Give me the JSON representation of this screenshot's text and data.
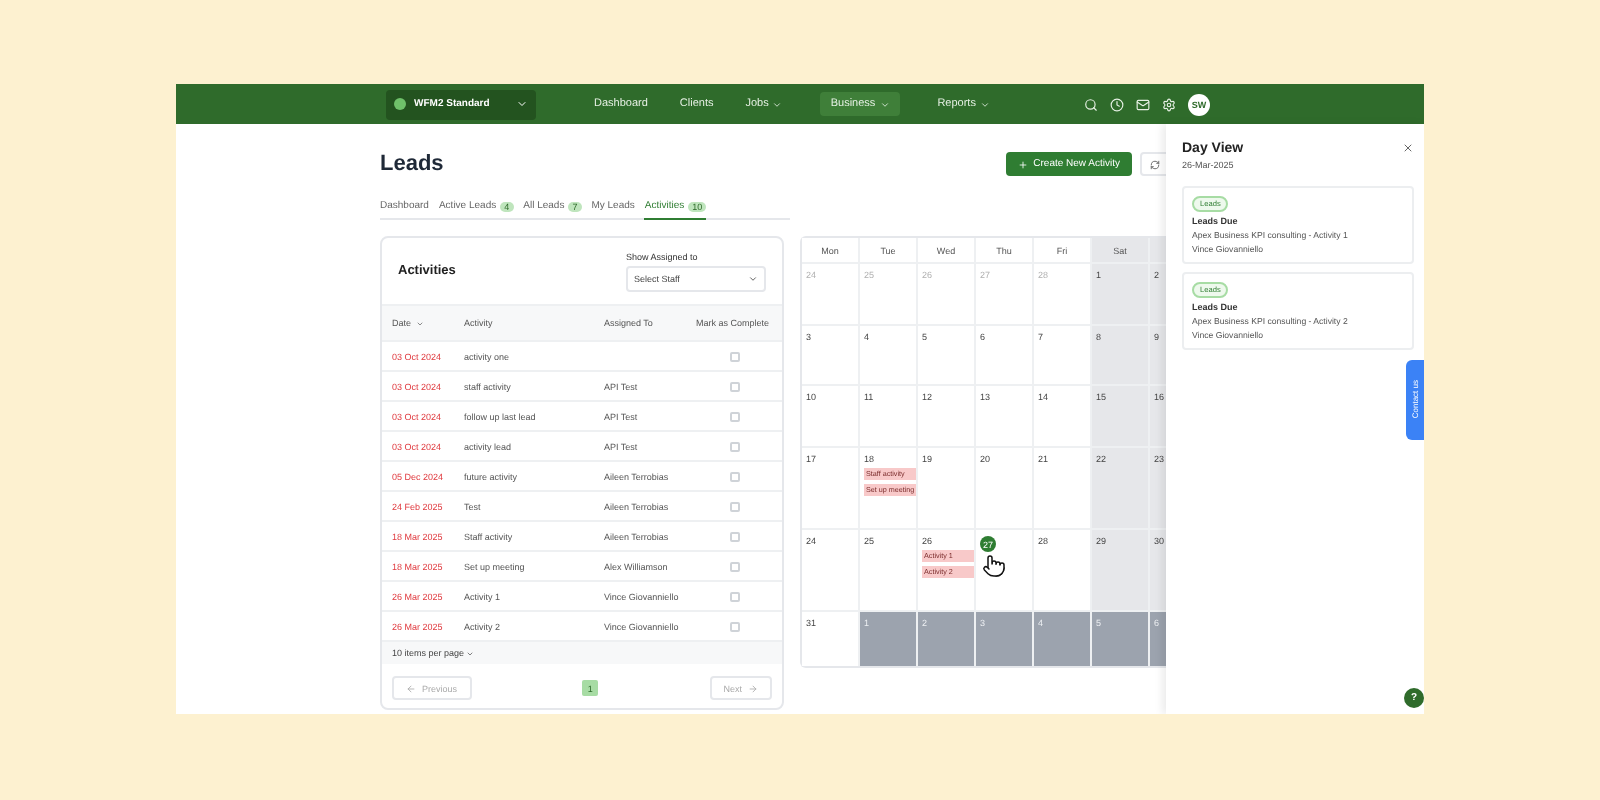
{
  "nav": {
    "workspace": "WFM2 Standard",
    "links": [
      {
        "label": "Dashboard",
        "dropdown": false,
        "selected": false
      },
      {
        "label": "Clients",
        "dropdown": false,
        "selected": false
      },
      {
        "label": "Jobs",
        "dropdown": true,
        "selected": false
      },
      {
        "label": "Business",
        "dropdown": true,
        "selected": true
      },
      {
        "label": "Reports",
        "dropdown": true,
        "selected": false
      }
    ],
    "avatar": "SW"
  },
  "page": {
    "title": "Leads",
    "create_button": "Create New Activity"
  },
  "tabs": [
    {
      "label": "Dashboard",
      "selected": false
    },
    {
      "label": "Active Leads",
      "count": "4",
      "selected": false
    },
    {
      "label": "All Leads",
      "count": "7",
      "selected": false
    },
    {
      "label": "My Leads",
      "selected": false
    },
    {
      "label": "Activities",
      "count": "10",
      "selected": true
    }
  ],
  "activities": {
    "title": "Activities",
    "filter_label": "Show Assigned to",
    "filter_placeholder": "Select Staff",
    "columns": [
      {
        "label": "Date",
        "sortable": true
      },
      {
        "label": "Activity",
        "sortable": false
      },
      {
        "label": "Assigned To",
        "sortable": false
      },
      {
        "label": "Mark as Complete",
        "sortable": false
      }
    ],
    "rows": [
      {
        "date": "03 Oct 2024",
        "activity": "activity one",
        "assigned": "",
        "checked": false
      },
      {
        "date": "03 Oct 2024",
        "activity": "staff activity",
        "assigned": "API Test",
        "checked": false
      },
      {
        "date": "03 Oct 2024",
        "activity": "follow up last lead",
        "assigned": "API Test",
        "checked": false
      },
      {
        "date": "03 Oct 2024",
        "activity": "activity lead",
        "assigned": "API Test",
        "checked": false
      },
      {
        "date": "05 Dec 2024",
        "activity": "future activity",
        "assigned": "Aileen Terrobias",
        "checked": false
      },
      {
        "date": "24 Feb 2025",
        "activity": "Test",
        "assigned": "Aileen Terrobias",
        "checked": false
      },
      {
        "date": "18 Mar 2025",
        "activity": "Staff activity",
        "assigned": "Aileen Terrobias",
        "checked": false
      },
      {
        "date": "18 Mar 2025",
        "activity": "Set up meeting",
        "assigned": "Alex Williamson",
        "checked": false
      },
      {
        "date": "26 Mar 2025",
        "activity": "Activity 1",
        "assigned": "Vince Giovanniello",
        "checked": false
      },
      {
        "date": "26 Mar 2025",
        "activity": "Activity 2",
        "assigned": "Vince Giovanniello",
        "checked": false
      }
    ],
    "per_page": "10 items per page",
    "previous": "Previous",
    "next": "Next",
    "pages": [
      {
        "label": "1",
        "selected": true
      }
    ]
  },
  "calendar": {
    "weekdays": [
      {
        "label": "Mon",
        "weekend": false
      },
      {
        "label": "Tue",
        "weekend": false
      },
      {
        "label": "Wed",
        "weekend": false
      },
      {
        "label": "Thu",
        "weekend": false
      },
      {
        "label": "Fri",
        "weekend": false
      },
      {
        "label": "Sat",
        "weekend": true
      },
      {
        "weekend": true
      }
    ],
    "weeks": [
      [
        {
          "day": "24",
          "kind": "prev"
        },
        {
          "day": "25",
          "kind": "prev"
        },
        {
          "day": "26",
          "kind": "prev"
        },
        {
          "day": "27",
          "kind": "prev"
        },
        {
          "day": "28",
          "kind": "prev"
        },
        {
          "day": "1",
          "kind": "current"
        },
        {
          "day": "2",
          "kind": "current"
        }
      ],
      [
        {
          "day": "3",
          "kind": "current"
        },
        {
          "day": "4",
          "kind": "current"
        },
        {
          "day": "5",
          "kind": "current"
        },
        {
          "day": "6",
          "kind": "current"
        },
        {
          "day": "7",
          "kind": "current"
        },
        {
          "day": "8",
          "kind": "current"
        },
        {
          "day": "9",
          "kind": "current"
        }
      ],
      [
        {
          "day": "10",
          "kind": "current"
        },
        {
          "day": "11",
          "kind": "current"
        },
        {
          "day": "12",
          "kind": "current"
        },
        {
          "day": "13",
          "kind": "current"
        },
        {
          "day": "14",
          "kind": "current"
        },
        {
          "day": "15",
          "kind": "current"
        },
        {
          "day": "16",
          "kind": "current"
        }
      ],
      [
        {
          "day": "17",
          "kind": "current"
        },
        {
          "day": "18",
          "kind": "current",
          "events": [
            "Staff activity",
            "Set up meeting"
          ]
        },
        {
          "day": "19",
          "kind": "current"
        },
        {
          "day": "20",
          "kind": "current"
        },
        {
          "day": "21",
          "kind": "current"
        },
        {
          "day": "22",
          "kind": "current"
        },
        {
          "day": "23",
          "kind": "current"
        }
      ],
      [
        {
          "day": "24",
          "kind": "current"
        },
        {
          "day": "25",
          "kind": "current"
        },
        {
          "day": "26",
          "kind": "current",
          "events": [
            "Activity 1",
            "Activity 2"
          ]
        },
        {
          "day": "27",
          "kind": "current",
          "selected": true
        },
        {
          "day": "28",
          "kind": "current"
        },
        {
          "day": "29",
          "kind": "current"
        },
        {
          "day": "30",
          "kind": "current"
        }
      ],
      [
        {
          "day": "31",
          "kind": "current"
        },
        {
          "day": "1",
          "kind": "next"
        },
        {
          "day": "2",
          "kind": "next"
        },
        {
          "day": "3",
          "kind": "next"
        },
        {
          "day": "4",
          "kind": "next"
        },
        {
          "day": "5",
          "kind": "next"
        },
        {
          "day": "6",
          "kind": "next"
        }
      ]
    ]
  },
  "day_view": {
    "title": "Day View",
    "date": "26-Mar-2025",
    "entries": [
      {
        "badge": "Leads",
        "title": "Leads Due",
        "description": "Apex Business KPI consulting - Activity 1",
        "person": "Vince Giovanniello"
      },
      {
        "badge": "Leads",
        "title": "Leads Due",
        "description": "Apex Business KPI consulting - Activity 2",
        "person": "Vince Giovanniello"
      }
    ]
  },
  "contact_tab": "Contact us",
  "help": "?"
}
